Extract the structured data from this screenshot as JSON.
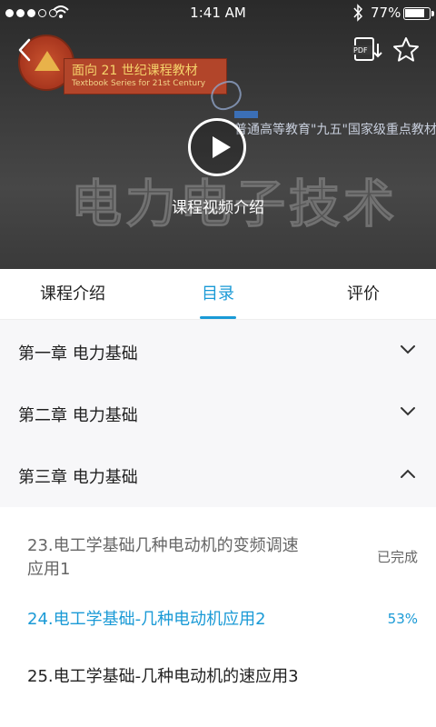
{
  "status_bar": {
    "time": "1:41 AM",
    "battery": "77%"
  },
  "video": {
    "caption": "课程视频介绍",
    "banner_main": "面向 21 世纪课程教材",
    "banner_sub": "Textbook Series for 21st Century",
    "badge_text": "普通高等教育\"九五\"国家级重点教材",
    "big_title": "电力电子技术"
  },
  "tabs": [
    {
      "label": "课程介绍",
      "active": false
    },
    {
      "label": "目录",
      "active": true
    },
    {
      "label": "评价",
      "active": false
    }
  ],
  "chapters": [
    {
      "label": "第一章  电力基础",
      "expanded": false
    },
    {
      "label": "第二章  电力基础",
      "expanded": false
    },
    {
      "label": "第三章  电力基础",
      "expanded": true
    }
  ],
  "lessons": [
    {
      "line1": "23.电工学基础几种电动机的变频调速",
      "line2": "应用1",
      "status": "已完成",
      "state": "completed"
    },
    {
      "line1": "24.电工学基础-几种电动机应用2",
      "line2": "",
      "status": "53%",
      "state": "in-progress"
    },
    {
      "line1": "25.电工学基础-几种电动机的速应用3",
      "line2": "",
      "status": "",
      "state": "not-started"
    }
  ],
  "colors": {
    "accent": "#1a9ad6",
    "completed_text": "#666666",
    "default_text": "#222222"
  }
}
